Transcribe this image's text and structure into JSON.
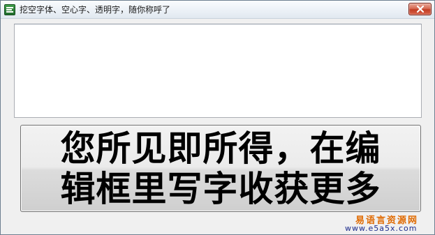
{
  "window": {
    "title": "挖空字体、空心字、透明字，随你称呼了"
  },
  "titlebar_icons": {
    "app_icon": "app-logo-icon",
    "close_icon": "close-icon",
    "close_color": "#c7402a"
  },
  "editor": {
    "value": "",
    "background": "#ffffff"
  },
  "button": {
    "line1": "您所见即所得，在编",
    "line2": "辑框里写字收获更多"
  },
  "watermark": {
    "cn": "易语言资源网",
    "url": "www.e5a5x.com",
    "cn_color": "#e06a00",
    "url_color": "#1c2b8c"
  }
}
